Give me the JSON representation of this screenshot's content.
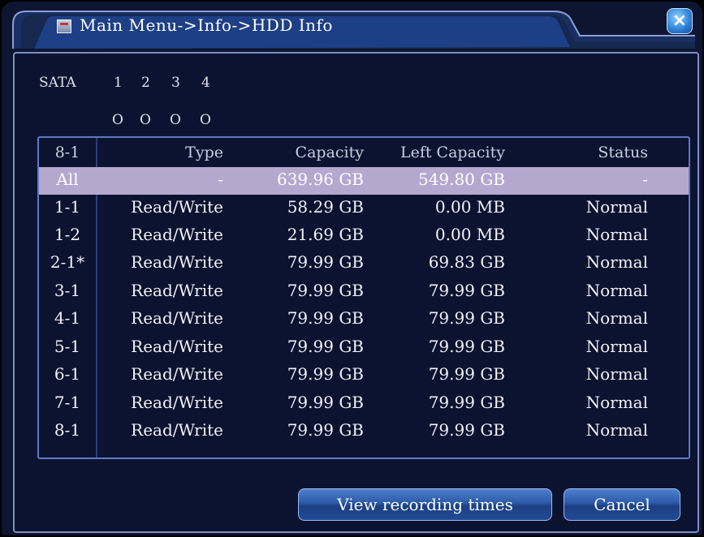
{
  "window": {
    "title": "Main Menu->Info->HDD Info",
    "close_label": "×",
    "accent_color": "#1d3f86",
    "frame_color": "#7c8fc4"
  },
  "sata": {
    "label": "SATA",
    "ports": [
      "1",
      "2",
      "3",
      "4"
    ],
    "indicators": [
      "O",
      "O",
      "O",
      "O"
    ]
  },
  "table": {
    "headers": {
      "id": "8-1",
      "type": "Type",
      "capacity": "Capacity",
      "left": "Left Capacity",
      "status": "Status"
    },
    "rows": [
      {
        "id": "All",
        "type": "-",
        "capacity": "639.96 GB",
        "left": "549.80 GB",
        "status": "-"
      },
      {
        "id": "1-1",
        "type": "Read/Write",
        "capacity": "58.29 GB",
        "left": "0.00 MB",
        "status": "Normal"
      },
      {
        "id": "1-2",
        "type": "Read/Write",
        "capacity": "21.69 GB",
        "left": "0.00 MB",
        "status": "Normal"
      },
      {
        "id": "2-1*",
        "type": "Read/Write",
        "capacity": "79.99 GB",
        "left": "69.83 GB",
        "status": "Normal"
      },
      {
        "id": "3-1",
        "type": "Read/Write",
        "capacity": "79.99 GB",
        "left": "79.99 GB",
        "status": "Normal"
      },
      {
        "id": "4-1",
        "type": "Read/Write",
        "capacity": "79.99 GB",
        "left": "79.99 GB",
        "status": "Normal"
      },
      {
        "id": "5-1",
        "type": "Read/Write",
        "capacity": "79.99 GB",
        "left": "79.99 GB",
        "status": "Normal"
      },
      {
        "id": "6-1",
        "type": "Read/Write",
        "capacity": "79.99 GB",
        "left": "79.99 GB",
        "status": "Normal"
      },
      {
        "id": "7-1",
        "type": "Read/Write",
        "capacity": "79.99 GB",
        "left": "79.99 GB",
        "status": "Normal"
      },
      {
        "id": "8-1",
        "type": "Read/Write",
        "capacity": "79.99 GB",
        "left": "79.99 GB",
        "status": "Normal"
      }
    ],
    "selected_color": "#b5a8cf"
  },
  "buttons": {
    "view_recording": "View recording times",
    "cancel": "Cancel"
  },
  "icons": {
    "title": "hdd-info-icon",
    "close": "close-icon"
  }
}
